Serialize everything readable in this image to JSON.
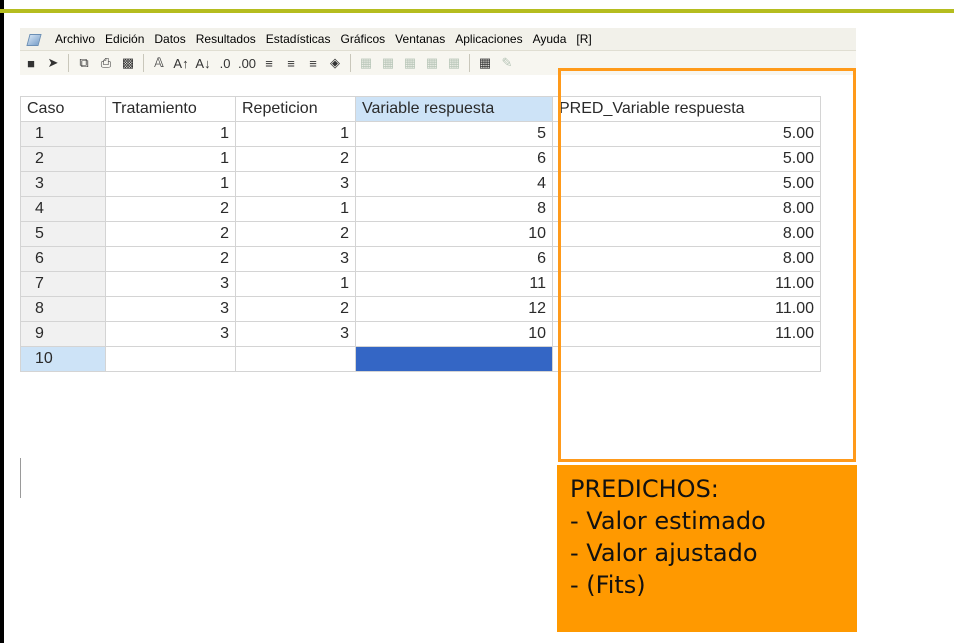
{
  "menubar": {
    "items": [
      "Archivo",
      "Edición",
      "Datos",
      "Resultados",
      "Estadísticas",
      "Gráficos",
      "Ventanas",
      "Aplicaciones",
      "Ayuda",
      "[R]"
    ]
  },
  "toolbar": {
    "icons": [
      "save-icon",
      "open-icon",
      "copy-icon",
      "paste-icon",
      "print-icon",
      "font-icon",
      "font-increase-icon",
      "font-decrease-icon",
      "decimal-increase-icon",
      "decimal-decrease-icon",
      "align-left-icon",
      "align-center-icon",
      "align-right-icon",
      "fill-color-icon",
      "insert-row-icon",
      "insert-column-icon",
      "delete-row-icon",
      "delete-column-icon",
      "filter-icon",
      "calculator-icon",
      "edit-icon"
    ]
  },
  "table": {
    "headers": [
      "Caso",
      "Tratamiento",
      "Repeticion",
      "Variable respuesta",
      "PRED_Variable respuesta"
    ],
    "rows": [
      {
        "caso": "1",
        "trat": "1",
        "rep": "1",
        "var": "5",
        "pred": "5.00"
      },
      {
        "caso": "2",
        "trat": "1",
        "rep": "2",
        "var": "6",
        "pred": "5.00"
      },
      {
        "caso": "3",
        "trat": "1",
        "rep": "3",
        "var": "4",
        "pred": "5.00"
      },
      {
        "caso": "4",
        "trat": "2",
        "rep": "1",
        "var": "8",
        "pred": "8.00"
      },
      {
        "caso": "5",
        "trat": "2",
        "rep": "2",
        "var": "10",
        "pred": "8.00"
      },
      {
        "caso": "6",
        "trat": "2",
        "rep": "3",
        "var": "6",
        "pred": "8.00"
      },
      {
        "caso": "7",
        "trat": "3",
        "rep": "1",
        "var": "11",
        "pred": "11.00"
      },
      {
        "caso": "8",
        "trat": "3",
        "rep": "2",
        "var": "12",
        "pred": "11.00"
      },
      {
        "caso": "9",
        "trat": "3",
        "rep": "3",
        "var": "10",
        "pred": "11.00"
      }
    ],
    "new_row_case": "10"
  },
  "callout": {
    "lines": [
      "PREDICHOS:",
      "- Valor estimado",
      "- Valor ajustado",
      "- (Fits)"
    ]
  },
  "colors": {
    "accent_bar": "#b5bd1f",
    "highlight": "#ff9900",
    "selection": "#3466c5",
    "header_selected": "#cde3f7"
  }
}
